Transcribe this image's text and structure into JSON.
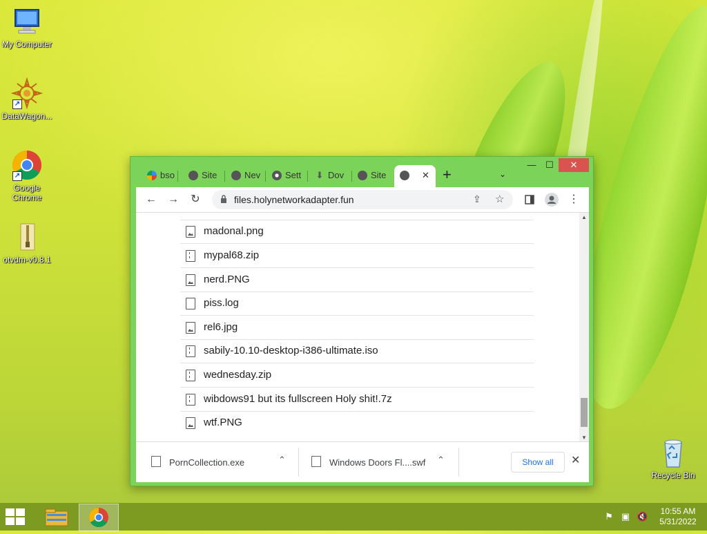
{
  "desktop": {
    "icons": [
      {
        "label": "My Computer",
        "icon": "computer-icon"
      },
      {
        "label": "DataWagon...",
        "icon": "datawagon-icon"
      },
      {
        "label": "Google Chrome",
        "icon": "chrome-icon"
      },
      {
        "label": "otvdm-v0.8.1",
        "icon": "folder-zip-icon"
      },
      {
        "label": "Recycle Bin",
        "icon": "recycle-bin-icon"
      }
    ]
  },
  "browser": {
    "tabs": [
      {
        "label": "bso",
        "icon": "google-icon"
      },
      {
        "label": "Site",
        "icon": "globe-icon"
      },
      {
        "label": "Nev",
        "icon": "globe-icon"
      },
      {
        "label": "Sett",
        "icon": "gear-icon"
      },
      {
        "label": "Dov",
        "icon": "download-icon"
      },
      {
        "label": "Site",
        "icon": "globe-icon"
      },
      {
        "label": "",
        "icon": "globe-icon",
        "active": true
      }
    ],
    "new_tab": "+",
    "tab_list": "⌄",
    "window_controls": {
      "minimize": "—",
      "maximize": "☐",
      "close": "✕"
    },
    "url": "files.holynetworkadapter.fun",
    "files": [
      {
        "name": "madonal.png",
        "type": "img"
      },
      {
        "name": "mypal68.zip",
        "type": "zip"
      },
      {
        "name": "nerd.PNG",
        "type": "img"
      },
      {
        "name": "piss.log",
        "type": "file"
      },
      {
        "name": "rel6.jpg",
        "type": "img"
      },
      {
        "name": "sabily-10.10-desktop-i386-ultimate.iso",
        "type": "zip"
      },
      {
        "name": "wednesday.zip",
        "type": "zip"
      },
      {
        "name": "wibdows91 but its fullscreen Holy shit!.7z",
        "type": "zip"
      },
      {
        "name": "wtf.PNG",
        "type": "img"
      }
    ],
    "scroll_position": 0.85,
    "downloads": [
      {
        "name": "PornCollection.exe"
      },
      {
        "name": "Windows Doors Fl....swf"
      }
    ],
    "show_all": "Show all"
  },
  "taskbar": {
    "clock_time": "10:55 AM",
    "clock_date": "5/31/2022"
  }
}
